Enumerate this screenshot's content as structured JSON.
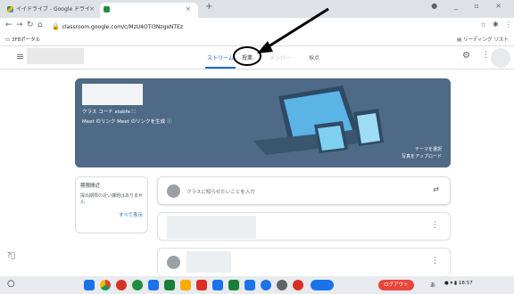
{
  "browser": {
    "tab_inactive_title": "イイドライブ - Google ドライ",
    "tab_close": "×",
    "new_tab": "+",
    "window_controls": "● _ ▫ ×",
    "url": "classroom.google.com/c/MzU4OTI3NzgxNTEz",
    "bookmark": "3F8ポータル",
    "reading_list": "リーディング リスト"
  },
  "classroom": {
    "tabs": [
      "ストリーム",
      "授業",
      "メンバー",
      "採点"
    ],
    "class_code_label": "クラス コード",
    "class_code": "xtabfe",
    "meet_link_label": "Meet のリンク",
    "meet_generate": "Meet のリンクを生成",
    "select_theme": "テーマを選択",
    "upload_photo": "写真をアップロード",
    "upcoming_title": "期限間近",
    "upcoming_text": "提出期限の近い課題はありません",
    "view_all": "すべて表示",
    "announce_placeholder": "クラスに知らせたいことを入力"
  },
  "taskbar": {
    "logout_label": "ログアウト",
    "time": "18:57"
  },
  "colors": {
    "accent": "#1967d2",
    "banner": "#4e6a86",
    "logout": "#e8453c"
  }
}
